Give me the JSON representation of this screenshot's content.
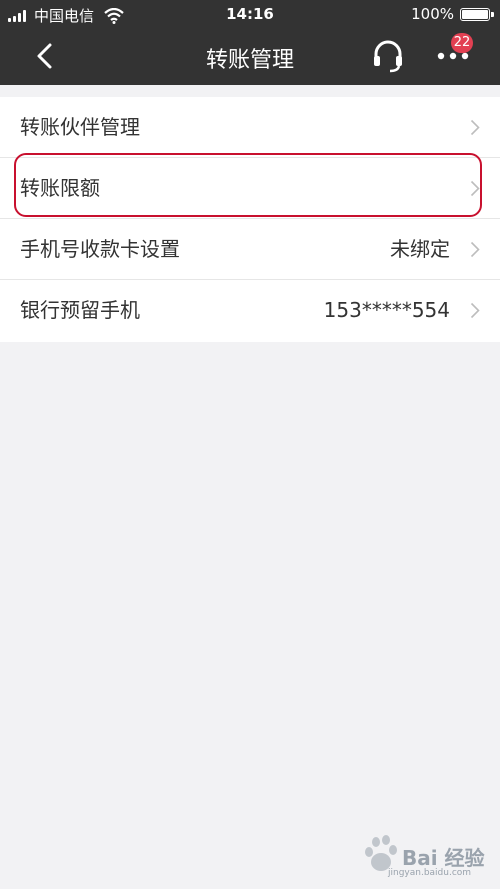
{
  "status_bar": {
    "carrier": "中国电信",
    "time": "14:16",
    "battery": "100%",
    "battery_level": 1.0
  },
  "nav": {
    "title": "转账管理",
    "badge_count": "22"
  },
  "list": {
    "items": [
      {
        "label": "转账伙伴管理",
        "value": ""
      },
      {
        "label": "转账限额",
        "value": ""
      },
      {
        "label": "手机号收款卡设置",
        "value": "未绑定"
      },
      {
        "label": "银行预留手机",
        "value": "153*****554"
      }
    ]
  },
  "watermark": {
    "text": "Bai 经验",
    "sub": "jingyan.baidu.com"
  },
  "colors": {
    "header_bg": "#333333",
    "badge": "#e24052",
    "highlight": "#c8102e",
    "page_bg": "#f2f2f4"
  }
}
